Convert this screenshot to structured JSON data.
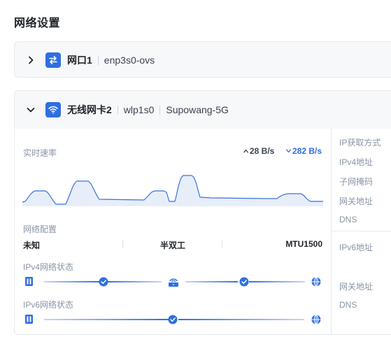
{
  "page_title": "网络设置",
  "card1": {
    "name": "网口1",
    "interface": "enp3s0-ovs",
    "icon": "ethernet-swap-icon"
  },
  "card2": {
    "name": "无线网卡2",
    "interface": "wlp1s0",
    "ssid": "Supowang-5G",
    "icon": "wifi-icon",
    "speed": {
      "label": "实时速率",
      "upload": "28 B/s",
      "download": "282 B/s"
    },
    "config": {
      "label": "网络配置",
      "speed_value": "未知",
      "duplex": "半双工",
      "mtu": "MTU1500"
    },
    "ipv4_status_label": "IPv4网络状态",
    "ipv6_status_label": "IPv6网络状态",
    "right_labels": {
      "ip_mode": "IP获取方式",
      "ipv4": "IPv4地址",
      "mask": "子网掩码",
      "gateway": "网关地址",
      "dns": "DNS",
      "ipv6": "IPv6地址",
      "gateway6": "网关地址",
      "dns6": "DNS"
    }
  },
  "colors": {
    "accent": "#2f6fe0",
    "chart_line": "#3a72d8",
    "chart_fill": "#dfe8f8"
  }
}
